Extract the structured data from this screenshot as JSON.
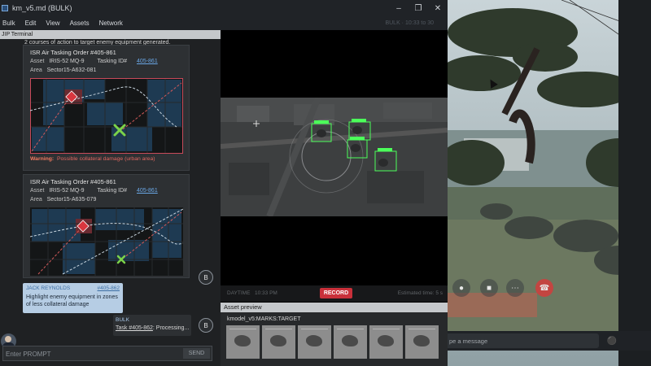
{
  "window": {
    "title": "km_v5.md (BULK)",
    "status": "BULK · 10:33 to 30"
  },
  "menu": [
    "Bulk",
    "Edit",
    "View",
    "Assets",
    "Network"
  ],
  "left_panel": {
    "header": "JIP Terminal",
    "generated_line": "2 courses of action to target enemy equipment generated.",
    "cards": [
      {
        "title": "ISR Air Tasking Order #405-861",
        "asset_label": "Asset",
        "asset_value": "IRIS-52 MQ-9",
        "tasking_label": "Tasking ID#",
        "tasking_value": "405-861",
        "area_label": "Area",
        "area_value": "Sector15-A632-081",
        "warning_label": "Warning:",
        "warning_text": "Possible collateral damage (urban area)"
      },
      {
        "title": "ISR Air Tasking Order #405-861",
        "asset_label": "Asset",
        "asset_value": "IRIS-52 MQ-9",
        "tasking_label": "Tasking ID#",
        "tasking_value": "405-861",
        "area_label": "Area",
        "area_value": "Sector15-A635-079"
      }
    ],
    "bot_initial": "B",
    "user_message": {
      "name": "JACK REYNOLDS",
      "task": "#405-862",
      "text": "Highlight enemy equipment in zones of less collateral damage"
    },
    "bot_message": {
      "name": "BULK",
      "task_link": "Task #405-862",
      "text": ": Processing..."
    },
    "prompt_placeholder": "Enter PROMPT",
    "send_label": "SEND"
  },
  "video": {
    "mode": "DAYTIME",
    "time": "10:33 PM",
    "record_label": "RECORD",
    "estimate": "Estimated time: 5 s",
    "detection_labels": [
      "TARGET",
      "TARGET",
      "TARGET",
      "TARGET"
    ]
  },
  "asset_preview": {
    "header": "Asset preview",
    "label": "kmodel_v5:MARKS:TARGET",
    "thumb_count": 6
  },
  "call": {
    "message_placeholder": "pe a message"
  },
  "colors": {
    "accent": "#6aa7e6",
    "record": "#c9303a",
    "warning": "#e0665f",
    "detection": "#4cff5a",
    "map_zone": "#1e3a52"
  }
}
